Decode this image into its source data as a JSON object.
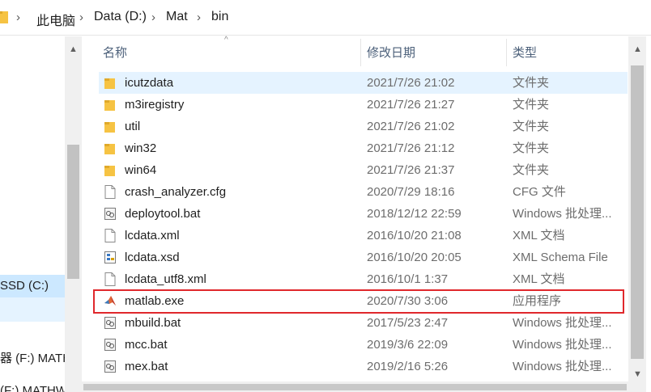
{
  "breadcrumb": {
    "items": [
      "此电脑",
      "Data (D:)",
      "Mat",
      "bin"
    ],
    "separator": "›"
  },
  "nav": {
    "items": [
      "SSD (C:)",
      "",
      "器 (F:) MATH",
      "(F:) MATHW"
    ]
  },
  "columns": {
    "name": "名称",
    "date": "修改日期",
    "type": "类型"
  },
  "files": [
    {
      "name": "icutzdata",
      "date": "2021/7/26 21:02",
      "type": "文件夹",
      "icon": "folder-icon"
    },
    {
      "name": "m3iregistry",
      "date": "2021/7/26 21:27",
      "type": "文件夹",
      "icon": "folder-icon"
    },
    {
      "name": "util",
      "date": "2021/7/26 21:02",
      "type": "文件夹",
      "icon": "folder-icon"
    },
    {
      "name": "win32",
      "date": "2021/7/26 21:12",
      "type": "文件夹",
      "icon": "folder-icon"
    },
    {
      "name": "win64",
      "date": "2021/7/26 21:37",
      "type": "文件夹",
      "icon": "folder-icon"
    },
    {
      "name": "crash_analyzer.cfg",
      "date": "2020/7/29 18:16",
      "type": "CFG 文件",
      "icon": "file-icon"
    },
    {
      "name": "deploytool.bat",
      "date": "2018/12/12 22:59",
      "type": "Windows 批处理...",
      "icon": "batch-file-icon"
    },
    {
      "name": "lcdata.xml",
      "date": "2016/10/20 21:08",
      "type": "XML 文档",
      "icon": "file-icon"
    },
    {
      "name": "lcdata.xsd",
      "date": "2016/10/20 20:05",
      "type": "XML Schema File",
      "icon": "xsd-file-icon"
    },
    {
      "name": "lcdata_utf8.xml",
      "date": "2016/10/1 1:37",
      "type": "XML 文档",
      "icon": "file-icon"
    },
    {
      "name": "matlab.exe",
      "date": "2020/7/30 3:06",
      "type": "应用程序",
      "icon": "matlab-icon"
    },
    {
      "name": "mbuild.bat",
      "date": "2017/5/23 2:47",
      "type": "Windows 批处理...",
      "icon": "batch-file-icon"
    },
    {
      "name": "mcc.bat",
      "date": "2019/3/6 22:09",
      "type": "Windows 批处理...",
      "icon": "batch-file-icon"
    },
    {
      "name": "mex.bat",
      "date": "2019/2/16 5:26",
      "type": "Windows 批处理...",
      "icon": "batch-file-icon"
    }
  ],
  "colors": {
    "highlight_box": "#e0282c",
    "selection": "#e5f3ff",
    "nav_selected": "#cce8ff",
    "folder": "#f6c343"
  }
}
